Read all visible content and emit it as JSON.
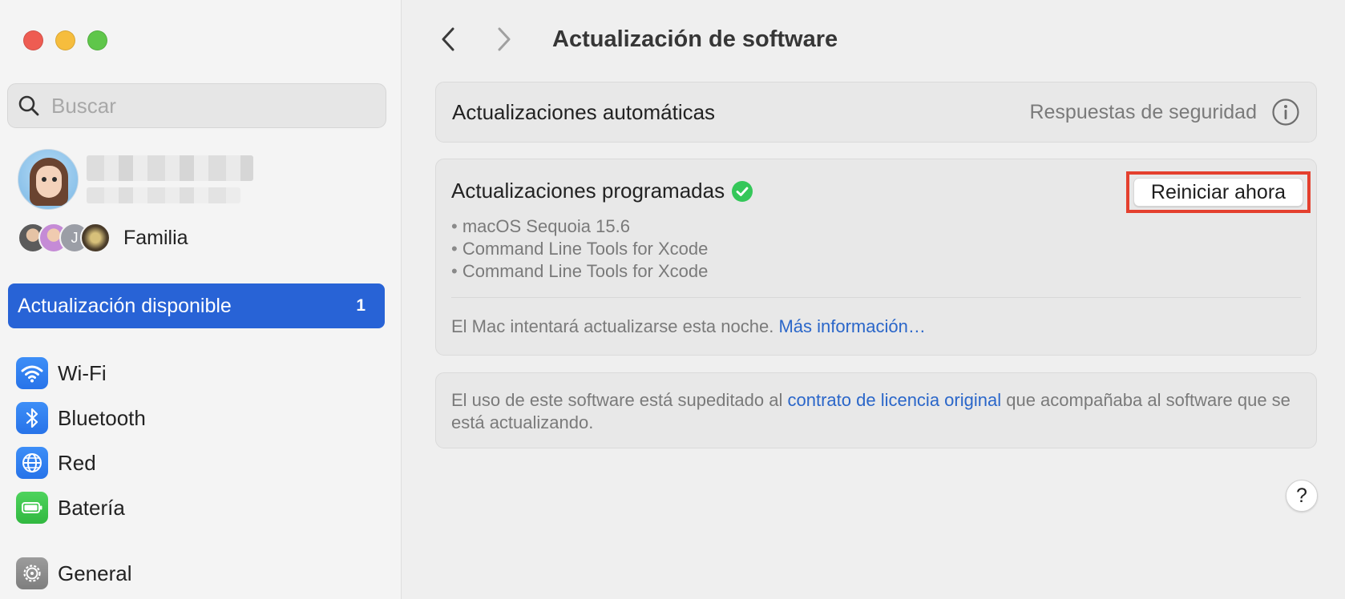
{
  "sidebar": {
    "search": {
      "placeholder": "Buscar"
    },
    "family_label": "Familia",
    "family_avatar_initial": "J",
    "update_item": {
      "label": "Actualización disponible",
      "count": "1"
    },
    "items": [
      {
        "label": "Wi-Fi",
        "icon": "wifi-icon"
      },
      {
        "label": "Bluetooth",
        "icon": "bluetooth-icon"
      },
      {
        "label": "Red",
        "icon": "globe-icon"
      },
      {
        "label": "Batería",
        "icon": "battery-icon"
      },
      {
        "label": "General",
        "icon": "gear-icon"
      }
    ]
  },
  "header": {
    "title": "Actualización de software"
  },
  "auto_updates": {
    "label": "Actualizaciones automáticas",
    "value": "Respuestas de seguridad"
  },
  "scheduled": {
    "title": "Actualizaciones programadas",
    "restart_label": "Reiniciar ahora",
    "items": [
      "macOS Sequoia 15.6",
      "Command Line Tools for Xcode",
      "Command Line Tools for Xcode"
    ],
    "footer_text": "El Mac intentará actualizarse esta noche.",
    "footer_link": "Más información…"
  },
  "license": {
    "text_before": "El uso de este software está supeditado al",
    "link": "contrato de licencia original",
    "text_after": "que acompañaba al software que se está actualizando."
  },
  "help_label": "?",
  "colors": {
    "accent": "#2863d6",
    "link": "#2a66c9",
    "success": "#34c759",
    "highlight_border": "#e4402e"
  }
}
